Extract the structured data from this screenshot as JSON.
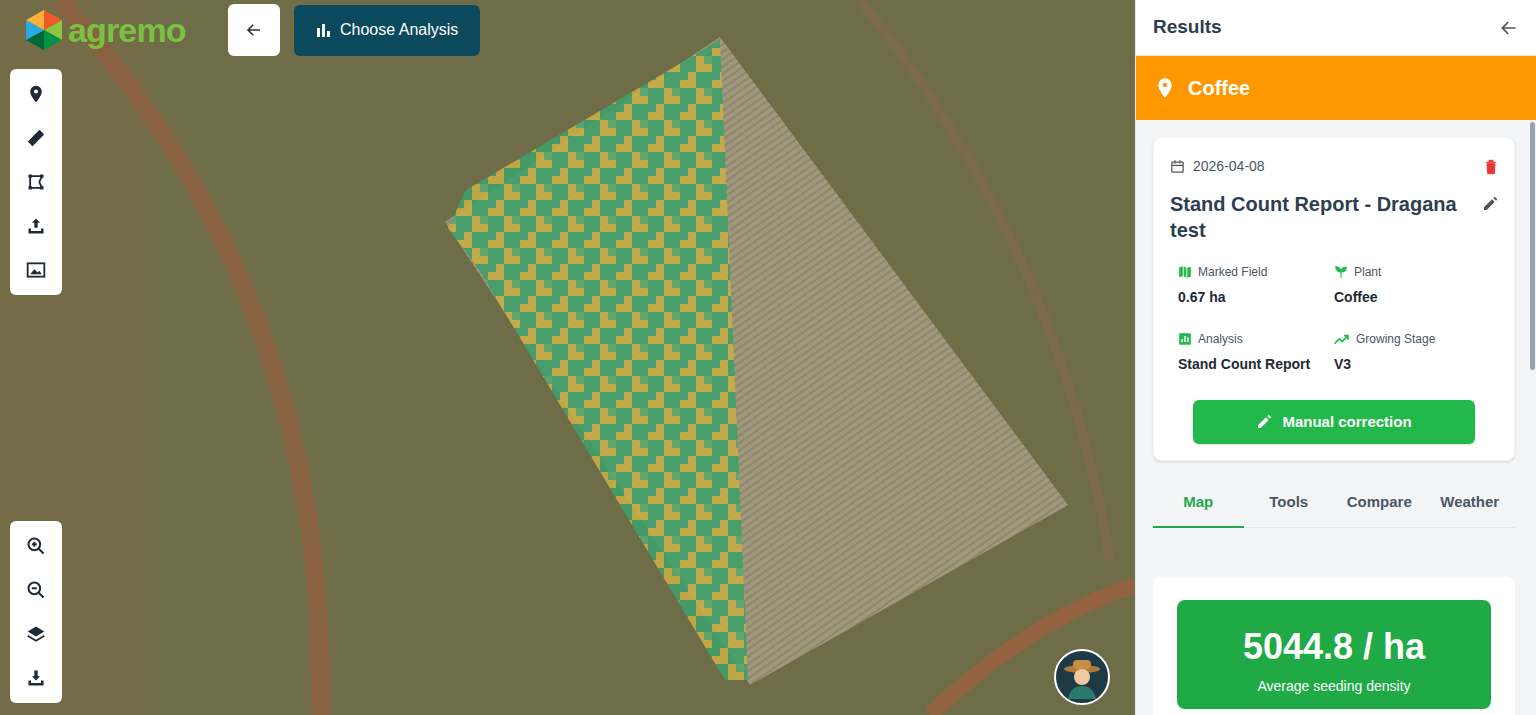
{
  "logo": {
    "text": "agremo"
  },
  "toolbar": {
    "choose_analysis": "Choose Analysis"
  },
  "results": {
    "title": "Results",
    "crop": "Coffee",
    "report": {
      "date": "2026-04-08",
      "title": "Stand Count Report - Dragana test",
      "fields": [
        {
          "kind": "area",
          "label": "Marked Field",
          "value": "0.67 ha"
        },
        {
          "kind": "plant",
          "label": "Plant",
          "value": "Coffee"
        },
        {
          "kind": "analysis",
          "label": "Analysis",
          "value": "Stand Count Report"
        },
        {
          "kind": "stage",
          "label": "Growing Stage",
          "value": "V3"
        }
      ],
      "action": "Manual correction"
    },
    "tabs": [
      {
        "label": "Map",
        "selected": true
      },
      {
        "label": "Tools",
        "selected": false
      },
      {
        "label": "Compare",
        "selected": false
      },
      {
        "label": "Weather",
        "selected": false
      }
    ],
    "summary": {
      "value": "5044.8 / ha",
      "label": "Average seeding density"
    }
  }
}
